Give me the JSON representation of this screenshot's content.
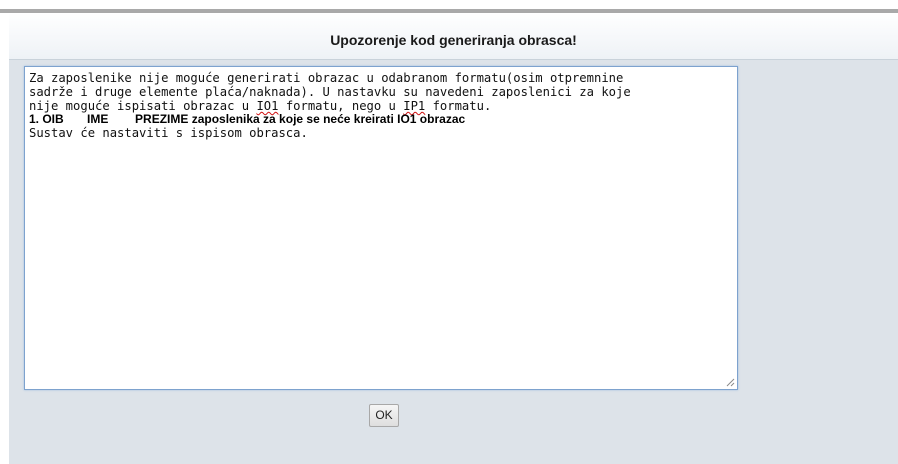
{
  "dialog": {
    "title": "Upozorenje kod generiranja obrasca!",
    "message": {
      "line1": "Za zaposlenike nije moguće generirati obrazac u odabranom formatu(osim otpremnine",
      "line2": "sadrže i druge elemente plaća/naknada). U nastavku su navedeni zaposlenici za koje",
      "line3_prefix": "nije moguće ispisati obrazac u ",
      "line3_code1": "IO1",
      "line3_mid": " formatu, nego u ",
      "line3_code2": "IP1",
      "line3_suffix": " formatu.",
      "employee_line": "1. OIB       IME        PREZIME zaposlenika za koje se neće kreirati IO1 obrazac",
      "closing_line": "Sustav će nastaviti s ispisom obrasca."
    },
    "ok_label": "OK"
  },
  "colors": {
    "dialog_background": "#dde3e9",
    "textarea_border": "#7da2ce",
    "spellcheck_underline": "#d01010"
  }
}
